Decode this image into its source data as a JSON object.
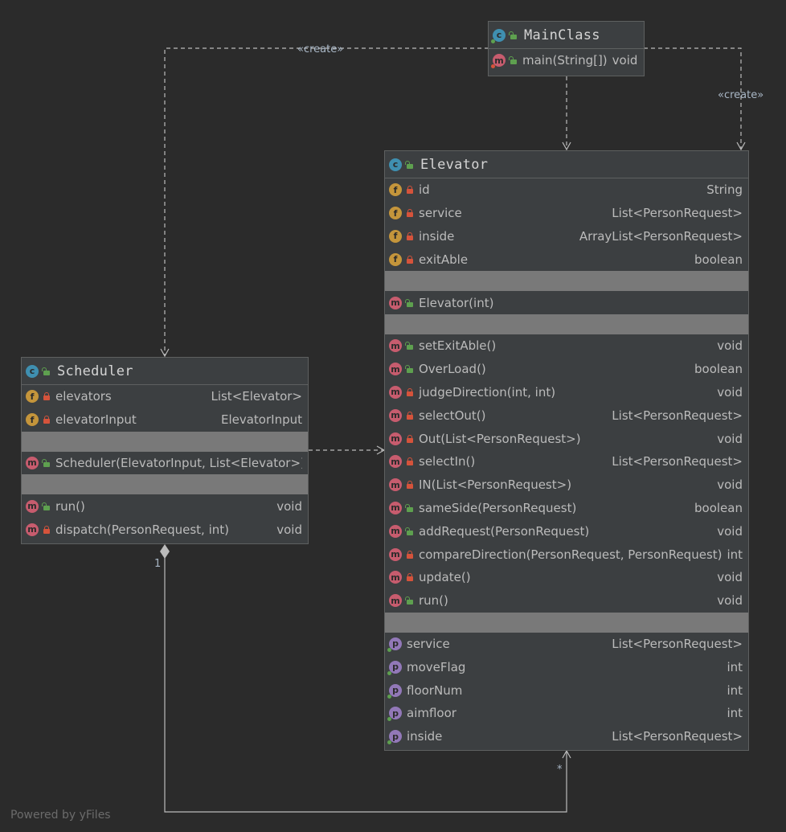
{
  "edges": {
    "create_label_1": "«create»",
    "create_label_2": "«create»",
    "multiplicity_one": "1",
    "multiplicity_many": "*"
  },
  "watermark": "Powered by yFiles",
  "main_class": {
    "title": "MainClass",
    "methods": [
      {
        "name": "main(String[])",
        "type": "void"
      }
    ]
  },
  "elevator": {
    "title": "Elevator",
    "fields": [
      {
        "name": "id",
        "type": "String"
      },
      {
        "name": "service",
        "type": "List<PersonRequest>"
      },
      {
        "name": "inside",
        "type": "ArrayList<PersonRequest>"
      },
      {
        "name": "exitAble",
        "type": "boolean"
      }
    ],
    "constructors": [
      {
        "name": "Elevator(int)",
        "type": ""
      }
    ],
    "methods": [
      {
        "name": "setExitAble()",
        "type": "void",
        "vis": "public"
      },
      {
        "name": "OverLoad()",
        "type": "boolean",
        "vis": "public"
      },
      {
        "name": "judgeDirection(int, int)",
        "type": "void",
        "vis": "private"
      },
      {
        "name": "selectOut()",
        "type": "List<PersonRequest>",
        "vis": "private"
      },
      {
        "name": "Out(List<PersonRequest>)",
        "type": "void",
        "vis": "private"
      },
      {
        "name": "selectIn()",
        "type": "List<PersonRequest>",
        "vis": "private"
      },
      {
        "name": "IN(List<PersonRequest>)",
        "type": "void",
        "vis": "private"
      },
      {
        "name": "sameSide(PersonRequest)",
        "type": "boolean",
        "vis": "public"
      },
      {
        "name": "addRequest(PersonRequest)",
        "type": "void",
        "vis": "public"
      },
      {
        "name": "compareDirection(PersonRequest, PersonRequest)",
        "type": "int",
        "vis": "private"
      },
      {
        "name": "update()",
        "type": "void",
        "vis": "private"
      },
      {
        "name": "run()",
        "type": "void",
        "vis": "public"
      }
    ],
    "properties": [
      {
        "name": "service",
        "type": "List<PersonRequest>"
      },
      {
        "name": "moveFlag",
        "type": "int"
      },
      {
        "name": "floorNum",
        "type": "int"
      },
      {
        "name": "aimfloor",
        "type": "int"
      },
      {
        "name": "inside",
        "type": "List<PersonRequest>"
      }
    ]
  },
  "scheduler": {
    "title": "Scheduler",
    "fields": [
      {
        "name": "elevators",
        "type": "List<Elevator>"
      },
      {
        "name": "elevatorInput",
        "type": "ElevatorInput"
      }
    ],
    "constructors": [
      {
        "name": "Scheduler(ElevatorInput, List<Elevator>)",
        "type": ""
      }
    ],
    "methods": [
      {
        "name": "run()",
        "type": "void",
        "vis": "public"
      },
      {
        "name": "dispatch(PersonRequest, int)",
        "type": "void",
        "vis": "private"
      }
    ]
  }
}
